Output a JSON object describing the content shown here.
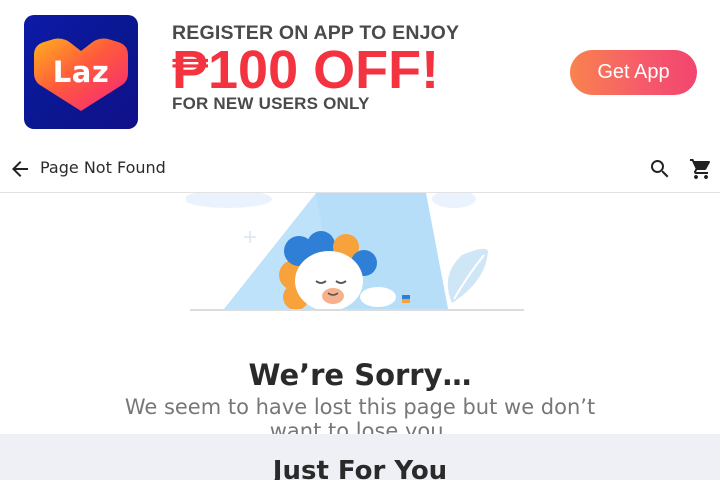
{
  "banner": {
    "logo_text": "Laz",
    "line1": "REGISTER ON APP TO ENJOY",
    "line2": "₱100 OFF!",
    "line3": "FOR NEW USERS ONLY",
    "cta_label": "Get App",
    "colors": {
      "accent": "#f3333f",
      "logo_bg": "#0f1aa0",
      "cta_start": "#f9834e",
      "cta_end": "#f2456f"
    }
  },
  "navbar": {
    "title": "Page Not Found",
    "back_icon": "arrow-back-icon",
    "search_icon": "search-icon",
    "cart_icon": "cart-icon"
  },
  "message": {
    "title": "We’re Sorry…",
    "text": "We seem to have lost this page but we don’t want to lose you."
  },
  "just_for_you": {
    "title": "Just For You"
  }
}
